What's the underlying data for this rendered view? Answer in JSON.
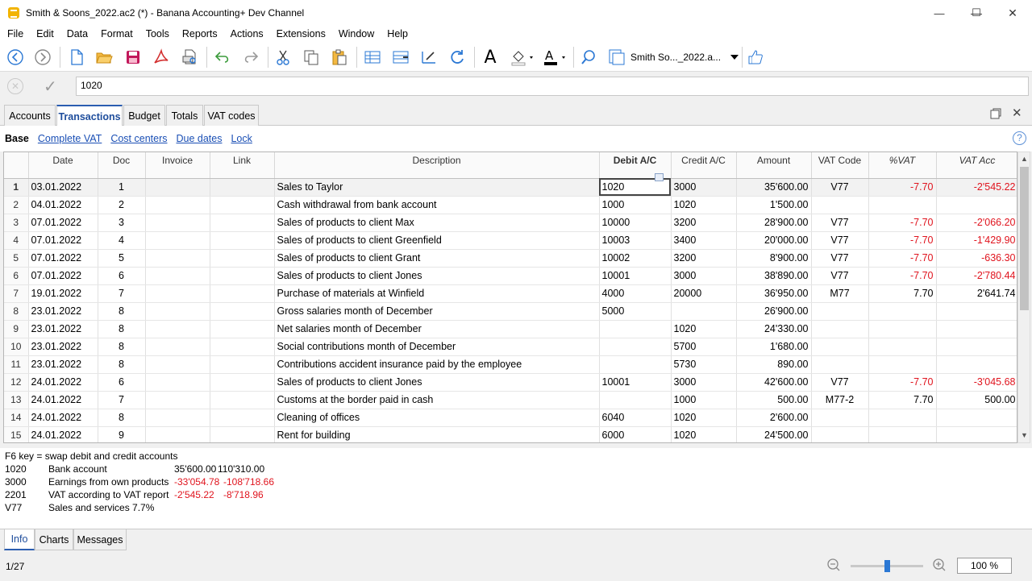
{
  "window": {
    "title": "Smith & Soons_2022.ac2 (*) - Banana Accounting+ Dev Channel",
    "minimize": "—",
    "maximize": "☐",
    "close": "✕"
  },
  "menu": [
    "File",
    "Edit",
    "Data",
    "Format",
    "Tools",
    "Reports",
    "Actions",
    "Extensions",
    "Window",
    "Help"
  ],
  "toolbar": {
    "file_label": "Smith   So..._2022.a..."
  },
  "editbar": {
    "cell_value": "1020"
  },
  "tabs": [
    "Accounts",
    "Transactions",
    "Budget",
    "Totals",
    "VAT codes"
  ],
  "views": [
    "Base",
    "Complete VAT",
    "Cost centers",
    "Due dates",
    "Lock"
  ],
  "columns": [
    "Date",
    "Doc",
    "Invoice",
    "Link",
    "Description",
    "Debit A/C",
    "Credit A/C",
    "Amount",
    "VAT Code",
    "%VAT",
    "VAT Acc"
  ],
  "rows": [
    [
      "1",
      "03.01.2022",
      "1",
      "",
      "",
      "Sales to Taylor",
      "1020",
      "3000",
      "35'600.00",
      "V77",
      "-7.70",
      "-2'545.22"
    ],
    [
      "2",
      "04.01.2022",
      "2",
      "",
      "",
      "Cash withdrawal from bank account",
      "1000",
      "1020",
      "1'500.00",
      "",
      "",
      ""
    ],
    [
      "3",
      "07.01.2022",
      "3",
      "",
      "",
      "Sales of products to client Max",
      "10000",
      "3200",
      "28'900.00",
      "V77",
      "-7.70",
      "-2'066.20"
    ],
    [
      "4",
      "07.01.2022",
      "4",
      "",
      "",
      "Sales of products to client Greenfield",
      "10003",
      "3400",
      "20'000.00",
      "V77",
      "-7.70",
      "-1'429.90"
    ],
    [
      "5",
      "07.01.2022",
      "5",
      "",
      "",
      "Sales of products to client Grant",
      "10002",
      "3200",
      "8'900.00",
      "V77",
      "-7.70",
      "-636.30"
    ],
    [
      "6",
      "07.01.2022",
      "6",
      "",
      "",
      "Sales of products to client Jones",
      "10001",
      "3000",
      "38'890.00",
      "V77",
      "-7.70",
      "-2'780.44"
    ],
    [
      "7",
      "19.01.2022",
      "7",
      "",
      "",
      "Purchase of materials at Winfield",
      "4000",
      "20000",
      "36'950.00",
      "M77",
      "7.70",
      "2'641.74"
    ],
    [
      "8",
      "23.01.2022",
      "8",
      "",
      "",
      "Gross salaries month of December",
      "5000",
      "",
      "26'900.00",
      "",
      "",
      ""
    ],
    [
      "9",
      "23.01.2022",
      "8",
      "",
      "",
      "Net salaries month of December",
      "",
      "1020",
      "24'330.00",
      "",
      "",
      ""
    ],
    [
      "10",
      "23.01.2022",
      "8",
      "",
      "",
      "Social contributions month of December",
      "",
      "5700",
      "1'680.00",
      "",
      "",
      ""
    ],
    [
      "11",
      "23.01.2022",
      "8",
      "",
      "",
      "Contributions accident insurance paid by the employee",
      "",
      "5730",
      "890.00",
      "",
      "",
      ""
    ],
    [
      "12",
      "24.01.2022",
      "6",
      "",
      "",
      "Sales of products to client Jones",
      "10001",
      "3000",
      "42'600.00",
      "V77",
      "-7.70",
      "-3'045.68"
    ],
    [
      "13",
      "24.01.2022",
      "7",
      "",
      "",
      "Customs at the border paid in cash",
      "",
      "1000",
      "500.00",
      "M77-2",
      "7.70",
      "500.00"
    ],
    [
      "14",
      "24.01.2022",
      "8",
      "",
      "",
      "Cleaning of offices",
      "6040",
      "1020",
      "2'600.00",
      "",
      "",
      ""
    ],
    [
      "15",
      "24.01.2022",
      "9",
      "",
      "",
      "Rent for building",
      "6000",
      "1020",
      "24'500.00",
      "",
      "",
      ""
    ]
  ],
  "info": {
    "hint": "F6 key = swap debit and credit accounts",
    "lines": [
      {
        "acc": "1020",
        "name": "Bank account",
        "v1": "35'600.00",
        "v2": "110'310.00",
        "red": false
      },
      {
        "acc": "3000",
        "name": "Earnings from own products",
        "v1": "-33'054.78",
        "v2": "-108'718.66",
        "red": true
      },
      {
        "acc": "2201",
        "name": "VAT according to VAT report",
        "v1": "-2'545.22",
        "v2": "-8'718.96",
        "red": true
      },
      {
        "acc": "V77",
        "name": "Sales and services 7.7%",
        "v1": "",
        "v2": "",
        "red": false
      }
    ]
  },
  "bottom_tabs": [
    "Info",
    "Charts",
    "Messages"
  ],
  "status": {
    "position": "1/27",
    "zoom": "100 %",
    "zoom_level_percent": 100
  }
}
